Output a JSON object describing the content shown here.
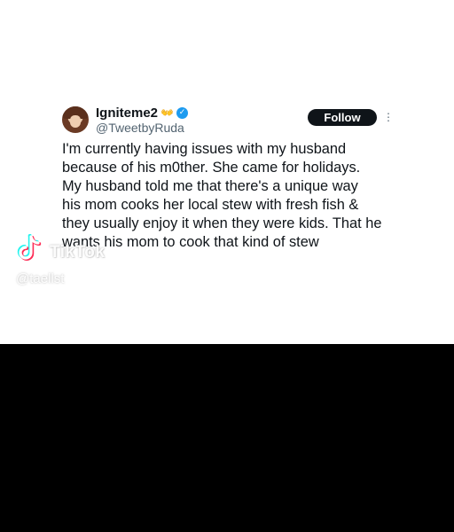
{
  "tweet": {
    "display_name": "Igniteme2",
    "name_emoji": "👐",
    "handle": "@TweetbyRuda",
    "follow_label": "Follow",
    "more_icon": "more-vertical-icon",
    "verified_icon": "verified-badge-icon",
    "text_lines": [
      "I'm currently having issues with my husband",
      "because of his m0ther. She came for holidays.",
      "My husband told me that there's a unique way",
      "his mom cooks her local stew with fresh fish &",
      "they usually enjoy it when they were kids. That he",
      "wants his mom to cook that kind of stew"
    ]
  },
  "watermark": {
    "brand": "TikTok",
    "handle": "@taellst",
    "logo_icon": "tiktok-logo-icon"
  },
  "colors": {
    "follow_bg": "#0f1419",
    "verified": "#1d9bf0",
    "handle_gray": "#536471",
    "bottom_band": "#000000"
  }
}
